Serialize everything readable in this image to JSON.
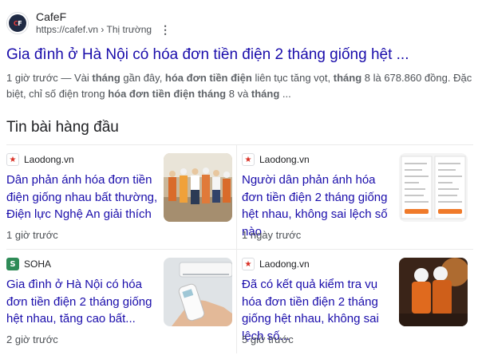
{
  "result": {
    "site_name": "CafeF",
    "url": "https://cafef.vn",
    "breadcrumb": "› Thị trường",
    "favicon_text": "CF",
    "title": "Gia đình ở Hà Nội có hóa đơn tiền điện 2 tháng giống hệt ...",
    "snippet_parts": [
      {
        "t": "1 giờ trước — Vài ",
        "b": false
      },
      {
        "t": "tháng",
        "b": true
      },
      {
        "t": " gần đây, ",
        "b": false
      },
      {
        "t": "hóa đơn tiền điện",
        "b": true
      },
      {
        "t": " liên tục tăng vọt, ",
        "b": false
      },
      {
        "t": "tháng",
        "b": true
      },
      {
        "t": " 8 là 678.860 đồng. Đặc biệt, chỉ số điện trong ",
        "b": false
      },
      {
        "t": "hóa đơn tiền điện tháng",
        "b": true
      },
      {
        "t": " 8 và ",
        "b": false
      },
      {
        "t": "tháng",
        "b": true
      },
      {
        "t": " ...",
        "b": false
      }
    ]
  },
  "top_stories": {
    "heading": "Tin bài hàng đầu",
    "cards": [
      {
        "publisher": "Laodong.vn",
        "publisher_icon": "laodong-star-icon",
        "headline": "Dân phản ánh hóa đơn tiền điện giống nhau bất thường, Điện lực Nghệ An giải thích",
        "time": "1 giờ trước",
        "thumb": "electricity-workers-photo"
      },
      {
        "publisher": "Laodong.vn",
        "publisher_icon": "laodong-star-icon",
        "headline": "Người dân phản ánh hóa đơn tiền điện 2 tháng giống hệt nhau, không sai lệch số nào",
        "time": "1 ngày trước",
        "thumb": "phone-bill-screenshots"
      },
      {
        "publisher": "SOHA",
        "publisher_icon": "soha-s-icon",
        "headline": "Gia đình ở Hà Nội có hóa đơn tiền điện 2 tháng giống hệt nhau, tăng cao bất...",
        "time": "2 giờ trước",
        "thumb": "ac-remote-photo"
      },
      {
        "publisher": "Laodong.vn",
        "publisher_icon": "laodong-star-icon",
        "headline": "Đã có kết quả kiểm tra vụ hóa đơn tiền điện 2 tháng giống hệt nhau, không sai lệch số...",
        "time": "5 giờ trước",
        "thumb": "linemen-at-night-photo"
      }
    ]
  },
  "icons": {
    "kebab": "⋮",
    "laodong": "★",
    "soha": "S"
  },
  "colors": {
    "link": "#1a0dab",
    "text": "#202124",
    "muted": "#4d5156",
    "laodong_red": "#d93025",
    "soha_green": "#2e8b57"
  }
}
